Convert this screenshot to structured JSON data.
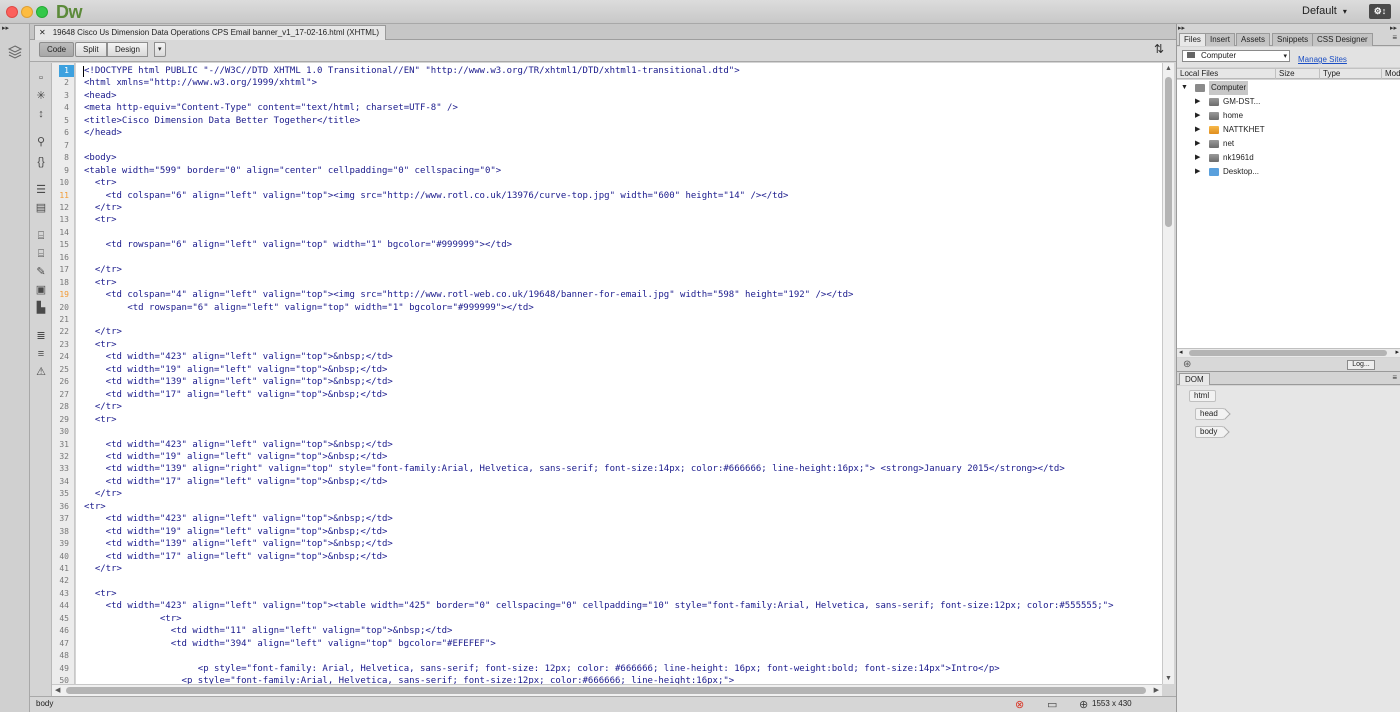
{
  "app": {
    "logo": "Dw",
    "workspace": "Default",
    "sync_label": "⚙↕"
  },
  "document": {
    "tab_title": "19648 Cisco Us Dimension Data Operations CPS Email banner_v1_17-02-16.html (XHTML)"
  },
  "view_toolbar": {
    "code_label": "Code",
    "split_label": "Split",
    "design_label": "Design"
  },
  "code_lines": [
    "<!DOCTYPE html PUBLIC \"-//W3C//DTD XHTML 1.0 Transitional//EN\" \"http://www.w3.org/TR/xhtml1/DTD/xhtml1-transitional.dtd\">",
    "<html xmlns=\"http://www.w3.org/1999/xhtml\">",
    "<head>",
    "<meta http-equiv=\"Content-Type\" content=\"text/html; charset=UTF-8\" />",
    "<title>Cisco Dimension Data Better Together</title>",
    "</head>",
    "",
    "<body>",
    "<table width=\"599\" border=\"0\" align=\"center\" cellpadding=\"0\" cellspacing=\"0\">",
    "  <tr>",
    "    <td colspan=\"6\" align=\"left\" valign=\"top\"><img src=\"http://www.rotl.co.uk/13976/curve-top.jpg\" width=\"600\" height=\"14\" /></td>",
    "  </tr>",
    "  <tr>",
    "",
    "    <td rowspan=\"6\" align=\"left\" valign=\"top\" width=\"1\" bgcolor=\"#999999\"></td>",
    "",
    "  </tr>",
    "  <tr>",
    "    <td colspan=\"4\" align=\"left\" valign=\"top\"><img src=\"http://www.rotl-web.co.uk/19648/banner-for-email.jpg\" width=\"598\" height=\"192\" /></td>",
    "        <td rowspan=\"6\" align=\"left\" valign=\"top\" width=\"1\" bgcolor=\"#999999\"></td>",
    "",
    "  </tr>",
    "  <tr>",
    "    <td width=\"423\" align=\"left\" valign=\"top\">&nbsp;</td>",
    "    <td width=\"19\" align=\"left\" valign=\"top\">&nbsp;</td>",
    "    <td width=\"139\" align=\"left\" valign=\"top\">&nbsp;</td>",
    "    <td width=\"17\" align=\"left\" valign=\"top\">&nbsp;</td>",
    "  </tr>",
    "  <tr>",
    "",
    "    <td width=\"423\" align=\"left\" valign=\"top\">&nbsp;</td>",
    "    <td width=\"19\" align=\"left\" valign=\"top\">&nbsp;</td>",
    "    <td width=\"139\" align=\"right\" valign=\"top\" style=\"font-family:Arial, Helvetica, sans-serif; font-size:14px; color:#666666; line-height:16px;\"> <strong>January 2015</strong></td>",
    "    <td width=\"17\" align=\"left\" valign=\"top\">&nbsp;</td>",
    "  </tr>",
    "<tr>",
    "    <td width=\"423\" align=\"left\" valign=\"top\">&nbsp;</td>",
    "    <td width=\"19\" align=\"left\" valign=\"top\">&nbsp;</td>",
    "    <td width=\"139\" align=\"left\" valign=\"top\">&nbsp;</td>",
    "    <td width=\"17\" align=\"left\" valign=\"top\">&nbsp;</td>",
    "  </tr>",
    "",
    "  <tr>",
    "    <td width=\"423\" align=\"left\" valign=\"top\"><table width=\"425\" border=\"0\" cellspacing=\"0\" cellpadding=\"10\" style=\"font-family:Arial, Helvetica, sans-serif; font-size:12px; color:#555555;\">",
    "              <tr>",
    "                <td width=\"11\" align=\"left\" valign=\"top\">&nbsp;</td>",
    "                <td width=\"394\" align=\"left\" valign=\"top\" bgcolor=\"#EFEFEF\">",
    "",
    "                     <p style=\"font-family: Arial, Helvetica, sans-serif; font-size: 12px; color: #666666; line-height: 16px; font-weight:bold; font-size:14px\">Intro</p>",
    "                  <p style=\"font-family:Arial, Helvetica, sans-serif; font-size:12px; color:#666666; line-height:16px;\">"
  ],
  "highlighted_lines": [
    11,
    19
  ],
  "status_bar": {
    "tag_selector": "body",
    "window_size": "1553 x 430"
  },
  "panels": {
    "tabs": [
      "Files",
      "Insert",
      "Assets",
      "Snippets",
      "CSS Designer"
    ],
    "active_tab": "Files",
    "site_select": "Computer",
    "manage_sites": "Manage Sites",
    "columns": [
      "Local Files",
      "Size",
      "Type",
      "Mod"
    ],
    "tree": [
      {
        "label": "Computer",
        "icon": "computer-icon",
        "level": 0,
        "expanded": true,
        "selected": true
      },
      {
        "label": "GM-DST...",
        "icon": "disk-icon",
        "level": 1
      },
      {
        "label": "home",
        "icon": "disk-icon",
        "level": 1
      },
      {
        "label": "NATTKHET",
        "icon": "orange-disk-icon",
        "level": 1
      },
      {
        "label": "net",
        "icon": "disk-icon",
        "level": 1
      },
      {
        "label": "nk1961d",
        "icon": "disk-icon",
        "level": 1
      },
      {
        "label": "Desktop...",
        "icon": "folder-icon",
        "level": 1
      }
    ],
    "log_button": "Log...",
    "dom_tab": "DOM",
    "dom_nodes": [
      "html",
      "head",
      "body"
    ]
  },
  "colors": {
    "line_number_highlight": "#3da1df",
    "tag_color": "#1a1a8c",
    "value_color": "#1a6e8c",
    "orange_line_number": "#f29b36"
  }
}
